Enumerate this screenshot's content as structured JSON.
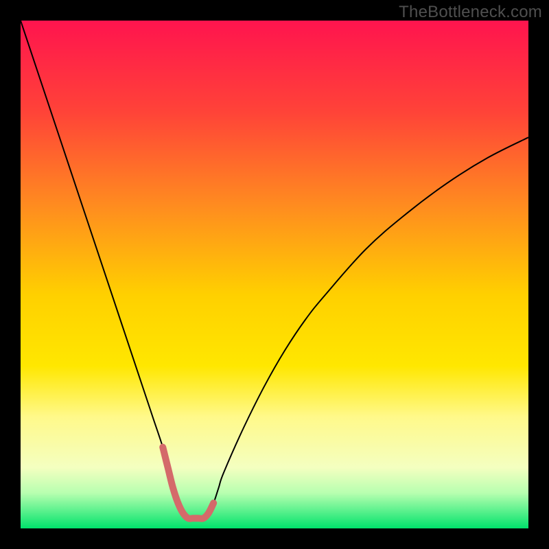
{
  "watermark": "TheBottleneck.com",
  "chart_data": {
    "type": "line",
    "title": "",
    "xlabel": "",
    "ylabel": "",
    "xlim": [
      0,
      100
    ],
    "ylim": [
      0,
      100
    ],
    "grid": false,
    "legend": false,
    "background_gradient": {
      "stops": [
        {
          "offset": 0.0,
          "color": "#ff144e"
        },
        {
          "offset": 0.18,
          "color": "#ff4338"
        },
        {
          "offset": 0.36,
          "color": "#ff8a20"
        },
        {
          "offset": 0.54,
          "color": "#ffd000"
        },
        {
          "offset": 0.68,
          "color": "#ffe700"
        },
        {
          "offset": 0.78,
          "color": "#fff98a"
        },
        {
          "offset": 0.88,
          "color": "#f4ffc0"
        },
        {
          "offset": 0.93,
          "color": "#b8ffb0"
        },
        {
          "offset": 1.0,
          "color": "#00e36b"
        }
      ]
    },
    "series": [
      {
        "name": "bottleneck-curve",
        "color": "#000000",
        "width": 2,
        "x": [
          0,
          4,
          8,
          12,
          16,
          20,
          24,
          26,
          28,
          29,
          30,
          31,
          32,
          33,
          34,
          35,
          36,
          37,
          38,
          39,
          40,
          44,
          48,
          52,
          56,
          60,
          68,
          76,
          84,
          92,
          100
        ],
        "y": [
          100,
          88,
          76,
          64,
          52,
          40,
          28,
          22,
          16,
          12,
          8,
          5,
          3,
          2,
          2,
          2,
          2,
          3,
          5,
          8,
          11,
          20,
          28,
          35,
          41,
          46,
          55,
          62,
          68,
          73,
          77
        ]
      },
      {
        "name": "optimal-band-highlight",
        "color": "#d46a6a",
        "width": 10,
        "x": [
          28,
          29,
          30,
          31,
          32,
          33,
          34,
          35,
          36,
          37,
          38
        ],
        "y": [
          16,
          12,
          8,
          5,
          3,
          2,
          2,
          2,
          2,
          3,
          5
        ]
      }
    ]
  }
}
